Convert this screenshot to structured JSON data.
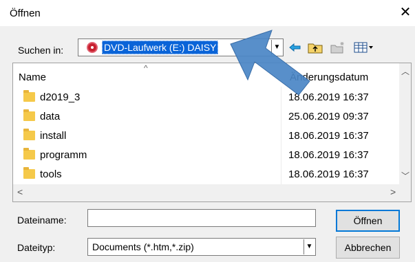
{
  "window": {
    "title": "Öffnen",
    "close_glyph": "✕"
  },
  "lookin": {
    "label": "Suchen in:",
    "value": "DVD-Laufwerk (E:) DAISY",
    "icon": "dvd-disc-icon"
  },
  "toolbar": {
    "icons": [
      "back-arrow-icon",
      "up-folder-icon",
      "new-folder-icon",
      "view-menu-icon"
    ]
  },
  "list": {
    "columns": {
      "name": "Name",
      "date": "Änderungsdatum"
    },
    "rows": [
      {
        "name": "d2019_3",
        "date": "18.06.2019 16:37"
      },
      {
        "name": "data",
        "date": "25.06.2019 09:37"
      },
      {
        "name": "install",
        "date": "18.06.2019 16:37"
      },
      {
        "name": "programm",
        "date": "18.06.2019 16:37"
      },
      {
        "name": "tools",
        "date": "18.06.2019 16:37"
      }
    ]
  },
  "filename": {
    "label": "Dateiname:",
    "value": ""
  },
  "filetype": {
    "label": "Dateityp:",
    "value": "Documents (*.htm,*.zip)"
  },
  "buttons": {
    "open": "Öffnen",
    "cancel": "Abbrechen"
  },
  "colors": {
    "selection": "#0a64d8",
    "annotation_arrow": "#4a86c5",
    "folder": "#f5c94a"
  }
}
